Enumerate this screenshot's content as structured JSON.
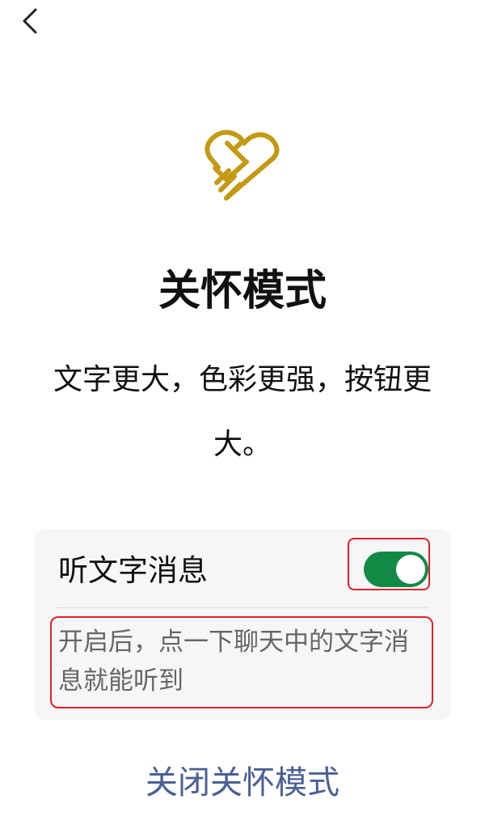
{
  "nav": {
    "back_icon": "chevron-left-icon"
  },
  "logo": {
    "icon": "heart-handshake-icon",
    "color": "#c49a13"
  },
  "title": "关怀模式",
  "description": "文字更大，色彩更强，按钮更大。",
  "setting": {
    "label": "听文字消息",
    "enabled": true,
    "toggle_color": "#128a46",
    "hint": "开启后，点一下聊天中的文字消息就能听到"
  },
  "close_link": {
    "label": "关闭关怀模式",
    "color": "#4a5f94"
  },
  "highlight_color": "#e0202a"
}
